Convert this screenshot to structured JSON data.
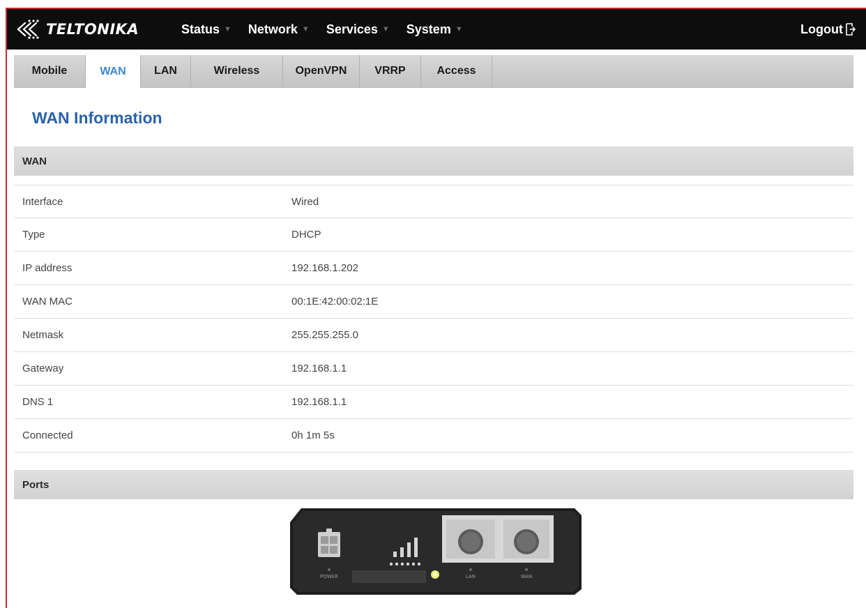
{
  "brand": {
    "name": "TELTONIKA"
  },
  "nav": {
    "items": [
      {
        "label": "Status"
      },
      {
        "label": "Network"
      },
      {
        "label": "Services"
      },
      {
        "label": "System"
      }
    ],
    "logout_label": "Logout"
  },
  "tabs": [
    {
      "label": "Mobile",
      "active": false
    },
    {
      "label": "WAN",
      "active": true
    },
    {
      "label": "LAN",
      "active": false
    },
    {
      "label": "Wireless",
      "active": false
    },
    {
      "label": "OpenVPN",
      "active": false
    },
    {
      "label": "VRRP",
      "active": false
    },
    {
      "label": "Access",
      "active": false
    }
  ],
  "page": {
    "title": "WAN Information"
  },
  "wan_section": {
    "title": "WAN",
    "rows": [
      {
        "label": "Interface",
        "value": "Wired"
      },
      {
        "label": "Type",
        "value": "DHCP"
      },
      {
        "label": "IP address",
        "value": "192.168.1.202"
      },
      {
        "label": "WAN MAC",
        "value": "00:1E:42:00:02:1E"
      },
      {
        "label": "Netmask",
        "value": "255.255.255.0"
      },
      {
        "label": "Gateway",
        "value": "192.168.1.1"
      },
      {
        "label": "DNS 1",
        "value": "192.168.1.1"
      },
      {
        "label": "Connected",
        "value": "0h 1m 5s"
      }
    ]
  },
  "ports_section": {
    "title": "Ports",
    "device_labels": {
      "power": "POWER",
      "lan": "LAN",
      "wan": "WAN"
    }
  },
  "colors": {
    "accent_red": "#c9272f",
    "title_blue": "#2a63a8",
    "active_tab_blue": "#3c86d1",
    "topbar": "#0d0d0d"
  }
}
